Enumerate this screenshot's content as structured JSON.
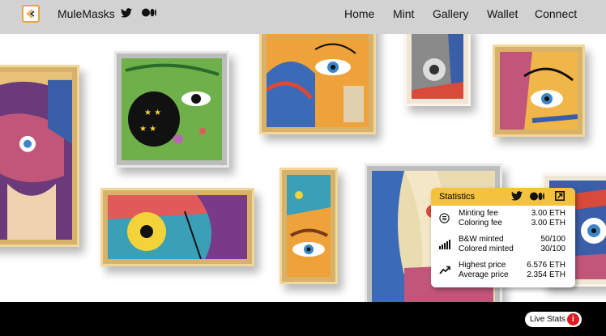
{
  "header": {
    "brand": "MuleMasks",
    "nav": [
      "Home",
      "Mint",
      "Gallery",
      "Wallet",
      "Connect"
    ],
    "social_icons": [
      "twitter-icon",
      "medium-icon"
    ]
  },
  "stats": {
    "title": "Statistics",
    "header_icons": [
      "twitter-icon",
      "medium-icon",
      "external-link-icon"
    ],
    "groups": [
      {
        "icon": "list-icon",
        "rows": [
          {
            "label": "Minting fee",
            "value": "3.00 ETH"
          },
          {
            "label": "Coloring fee",
            "value": "3.00 ETH"
          }
        ]
      },
      {
        "icon": "bar-signal-icon",
        "rows": [
          {
            "label": "B&W minted",
            "value": "50/100"
          },
          {
            "label": "Colored minted",
            "value": "30/100"
          }
        ]
      },
      {
        "icon": "trend-up-icon",
        "rows": [
          {
            "label": "Highest price",
            "value": "6.576 ETH"
          },
          {
            "label": "Average price",
            "value": "2.354 ETH"
          }
        ]
      }
    ]
  },
  "live_stats": {
    "label": "Live Stats",
    "badge": "i"
  },
  "colors": {
    "topbar": "#d2d2d2",
    "accent": "#f4c23d",
    "footer": "#000000",
    "logo": "#e8a24a",
    "badge": "#e01b24"
  }
}
